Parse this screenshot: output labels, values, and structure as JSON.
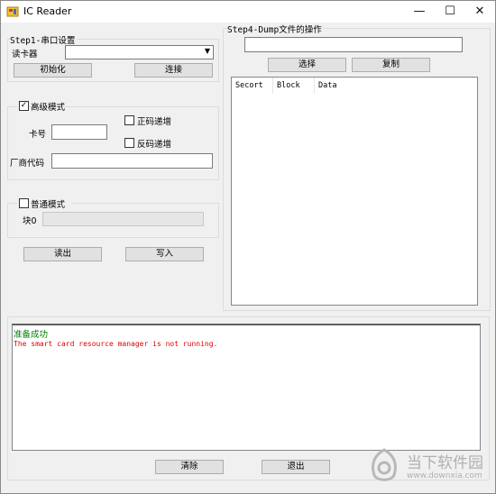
{
  "window": {
    "title": "IC Reader",
    "minimize": "—",
    "maximize": "☐",
    "close": "✕"
  },
  "step1": {
    "title": "Step1-串口设置",
    "reader_label": "读卡器",
    "reader_value": "",
    "init_button": "初始化",
    "connect_button": "连接"
  },
  "advanced": {
    "title": "高级模式",
    "checked": true,
    "card_label": "卡号",
    "card_value": "",
    "vendor_label": "厂商代码",
    "vendor_value": "",
    "inc_label": "正码递增",
    "dec_label": "反码递增"
  },
  "normal": {
    "title": "普通模式",
    "checked": false,
    "block_label": "块0",
    "block_value": ""
  },
  "actions": {
    "read": "读出",
    "write": "写入"
  },
  "step4": {
    "title": "Step4-Dump文件的操作",
    "path_value": "",
    "select_button": "选择",
    "copy_button": "复制",
    "columns": [
      "Secort",
      "Block",
      "Data"
    ]
  },
  "log": {
    "lines": [
      {
        "text": "准备成功",
        "color": "#008000"
      },
      {
        "text": "The smart card resource manager is not running.",
        "color": "#e00000"
      }
    ],
    "clear_button": "清除",
    "exit_button": "退出"
  },
  "watermark": {
    "cn": "当下软件园",
    "url": "www.downxia.com"
  }
}
